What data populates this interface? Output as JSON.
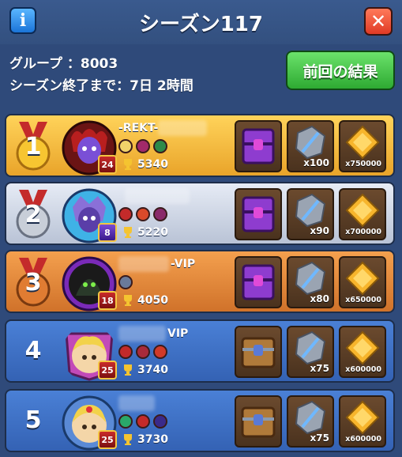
{
  "header": {
    "title": "シーズン117",
    "info_label": "i",
    "close_label": "✕"
  },
  "info": {
    "group_label": "グループ ：8003",
    "season_end_label": "シーズン終了まで：7日 2時間"
  },
  "results_button": {
    "label": "前回の結果"
  },
  "rows": [
    {
      "rank": "1",
      "name": "-REKT-",
      "level": "24",
      "trophies": "5340",
      "chest": "purple",
      "sword_qty": "x100",
      "coin_qty": "x750000"
    },
    {
      "rank": "2",
      "name": "",
      "level": "8",
      "trophies": "5220",
      "chest": "purple",
      "sword_qty": "x90",
      "coin_qty": "x700000"
    },
    {
      "rank": "3",
      "name": "-VIP",
      "level": "18",
      "trophies": "4050",
      "chest": "purple",
      "sword_qty": "x80",
      "coin_qty": "x650000"
    },
    {
      "rank": "4",
      "name": "VIP",
      "level": "25",
      "trophies": "3740",
      "chest": "wood",
      "sword_qty": "x75",
      "coin_qty": "x600000"
    },
    {
      "rank": "5",
      "name": "",
      "level": "25",
      "trophies": "3730",
      "chest": "wood",
      "sword_qty": "x75",
      "coin_qty": "x600000"
    }
  ],
  "colors": {
    "gold_row": "#f2b632",
    "silver_row": "#c9d2e3",
    "bronze_row": "#e0883e",
    "blue_row": "#3c6fc4",
    "green_button": "#39b53d"
  }
}
